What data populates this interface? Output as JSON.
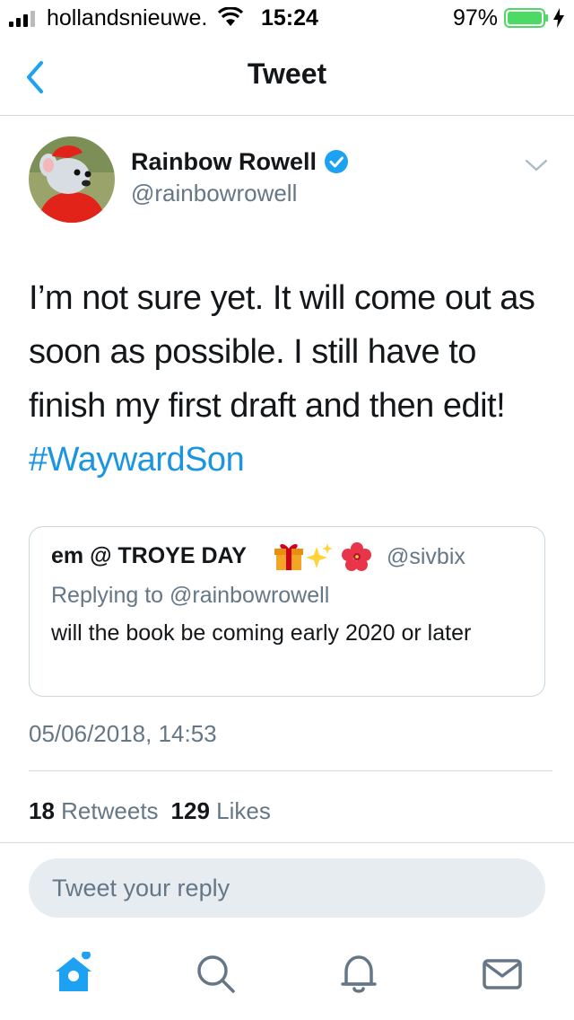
{
  "status_bar": {
    "carrier": "hollandsnieuwe.",
    "time": "15:24",
    "battery": "97%"
  },
  "header": {
    "title": "Tweet"
  },
  "tweet": {
    "author_name": "Rainbow Rowell",
    "author_handle": "@rainbowrowell",
    "text": "I’m not sure yet. It will come out as soon as possible. I still have to finish my first draft and then edit! ",
    "hashtag": "#WaywardSon",
    "timestamp": "05/06/2018, 14:53"
  },
  "quoted_tweet": {
    "author_name": "em @ TROYE DAY",
    "emojis": [
      "gift-icon",
      "sparkles-icon",
      "hibiscus-icon"
    ],
    "author_handle": "@sivbix",
    "replying_to": "Replying to @rainbowrowell",
    "text": "will the book be coming early 2020 or later"
  },
  "stats": {
    "retweets_count": "18",
    "retweets_label": "Retweets",
    "likes_count": "129",
    "likes_label": "Likes"
  },
  "reply": {
    "placeholder": "Tweet your reply"
  },
  "tabbar": {
    "items": [
      "home-icon",
      "search-icon",
      "notifications-icon",
      "messages-icon"
    ]
  },
  "colors": {
    "accent": "#1da1f2",
    "hashtag": "#1b95e0",
    "muted": "#657786",
    "battery": "#4cd964"
  }
}
